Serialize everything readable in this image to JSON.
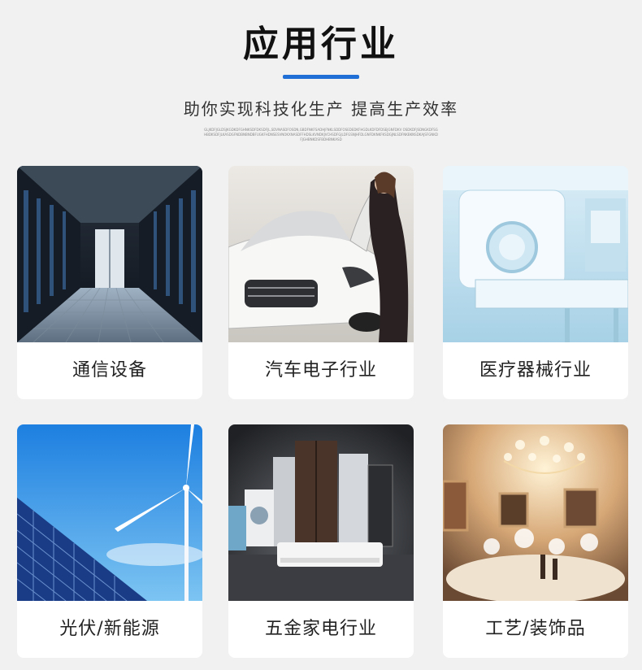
{
  "header": {
    "title": "应用行业",
    "subtitle": "助你实现科技化生产  提高生产效率",
    "fine_print": "GLJKDFJGLDSJKGDKDFGHNKSDFDKSDFJL,SDVNASDFOSDN,GBDFNKFSADHJFNKLSDDFOSEDEDKFHGDLKDFDFDSEJGNFDKV OSDKDFJSDNGKDFSGHBDKSDFJLKASDGFNDBNBNDBFUGKFHDNSESVNOKXNASDFFHDSLKVNDKJVCHSDFGJLDFGSNJHFDLGNFDKNKFKSDGJNLSDFNKBKNSDKAJSFGNKDFJGHBNKDSFBDHBNKASD"
  },
  "cards": [
    {
      "label": "通信设备"
    },
    {
      "label": "汽车电子行业"
    },
    {
      "label": "医疗器械行业"
    },
    {
      "label": "光伏/新能源"
    },
    {
      "label": "五金家电行业"
    },
    {
      "label": "工艺/装饰品"
    }
  ],
  "colors": {
    "accent": "#1f6fd6",
    "background": "#f1f1f1",
    "card": "#ffffff"
  }
}
